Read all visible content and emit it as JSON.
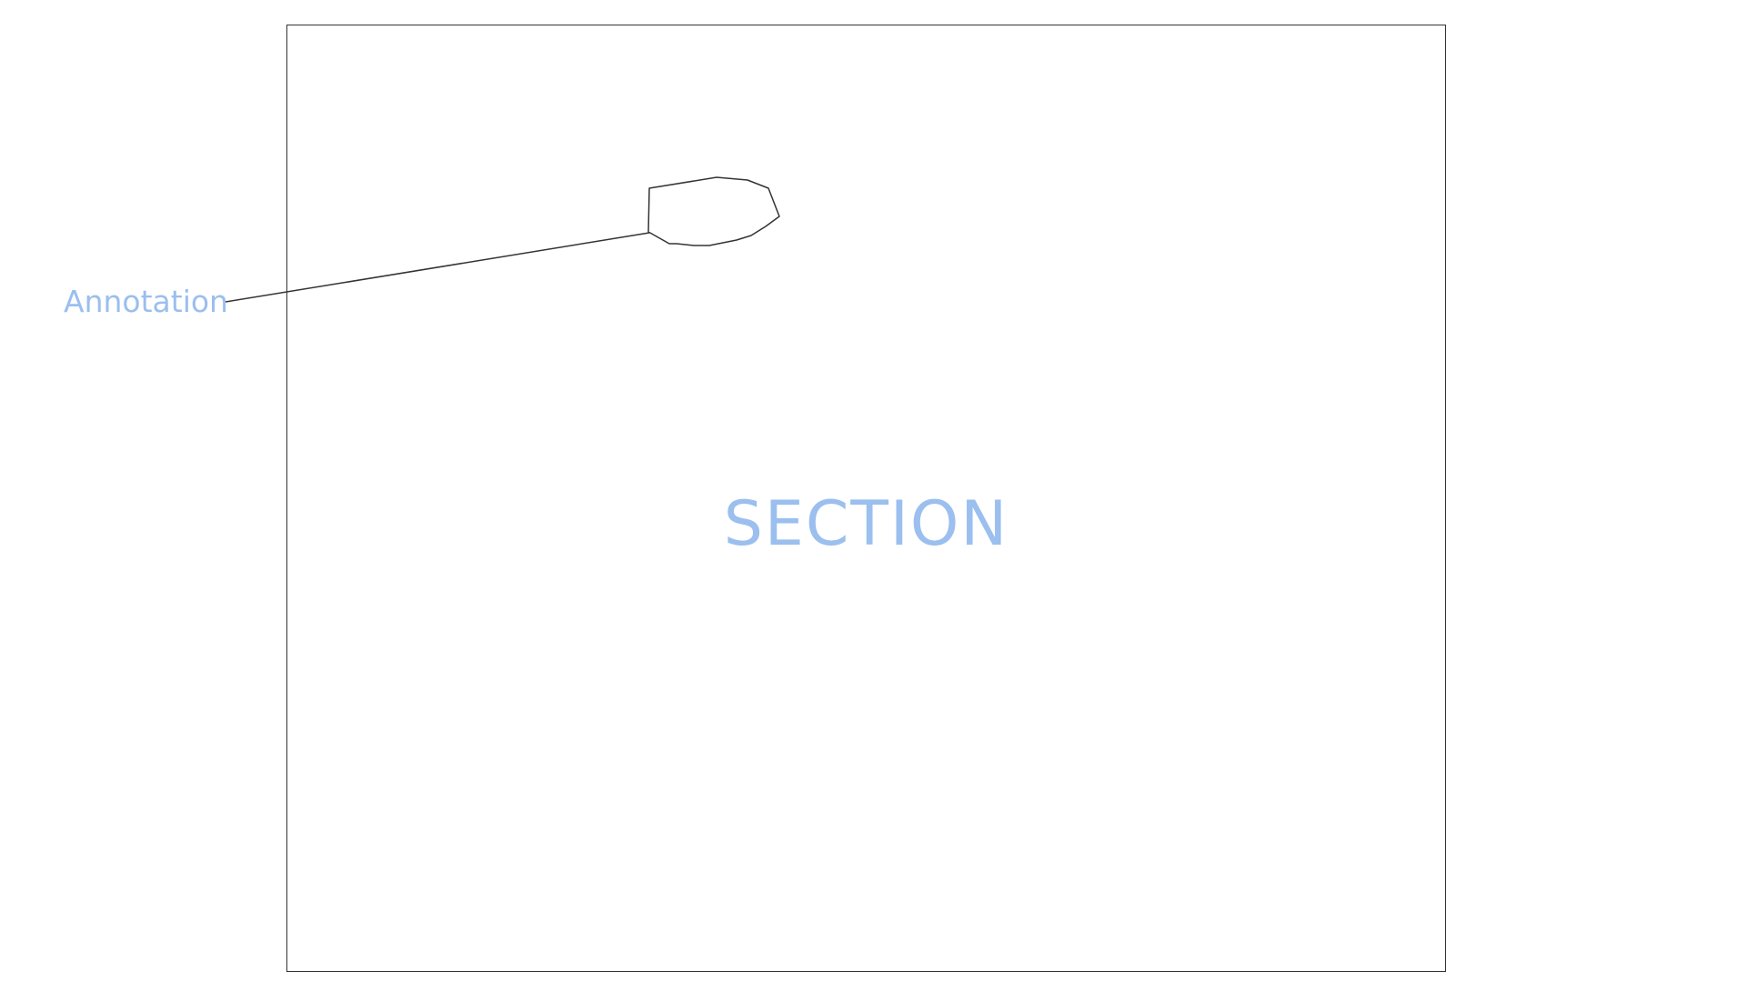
{
  "section": {
    "label": "SECTION"
  },
  "annotation": {
    "label": "Annotation"
  },
  "colors": {
    "label_text": "#9bbfee",
    "outline": "#333333",
    "background": "#ffffff"
  }
}
